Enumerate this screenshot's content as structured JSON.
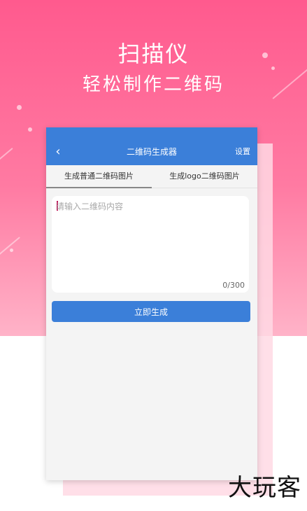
{
  "hero": {
    "title": "扫描仪",
    "subtitle": "轻松制作二维码"
  },
  "navbar": {
    "back_icon": "chevron-left-icon",
    "title": "二维码生成器",
    "settings_label": "设置"
  },
  "tabs": [
    {
      "label": "生成普通二维码图片",
      "active": true
    },
    {
      "label": "生成logo二维码图片",
      "active": false
    }
  ],
  "content_input": {
    "placeholder": "请输入二维码内容",
    "value": "",
    "counter": "0/300"
  },
  "generate_button": {
    "label": "立即生成"
  },
  "watermark": {
    "text": "大玩客"
  },
  "colors": {
    "hero_top": "#ff5a8e",
    "accent_blue": "#3b7fd9"
  }
}
